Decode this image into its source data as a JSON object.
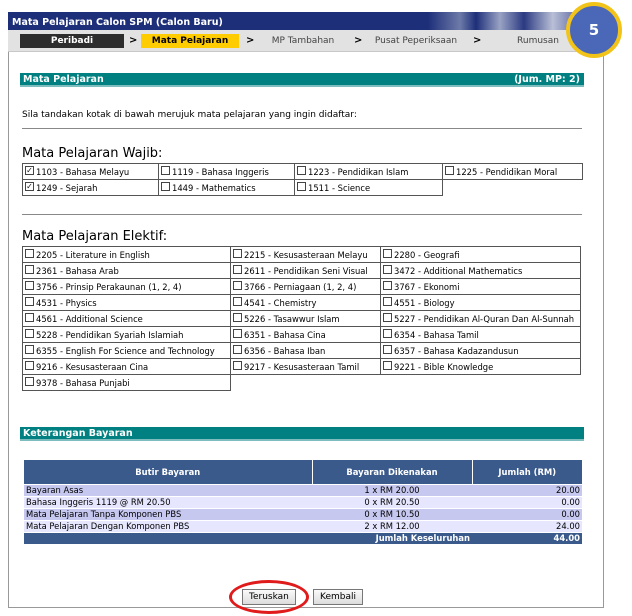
{
  "window": {
    "title": "Mata Pelajaran Calon SPM (Calon Baru)"
  },
  "badge": {
    "number": "5"
  },
  "steps": [
    {
      "label": "Peribadi"
    },
    {
      "label": "Mata Pelajaran"
    },
    {
      "label": "MP Tambahan"
    },
    {
      "label": "Pusat Peperiksaan"
    },
    {
      "label": "Rumusan"
    }
  ],
  "step_separator": ">",
  "subjects_section": {
    "title": "Mata Pelajaran",
    "count": "(Jum. MP: 2)"
  },
  "instruction": "Sila tandakan kotak di bawah merujuk mata pelajaran yang ingin didaftar:",
  "compulsory": {
    "heading": "Mata Pelajaran Wajib:",
    "rows": [
      [
        {
          "label": "1103 - Bahasa Melayu",
          "checked": true
        },
        {
          "label": "1119 - Bahasa Inggeris",
          "checked": false
        },
        {
          "label": "1223 - Pendidikan Islam",
          "checked": false
        },
        {
          "label": "1225 - Pendidikan Moral",
          "checked": false
        }
      ],
      [
        {
          "label": "1249 - Sejarah",
          "checked": true
        },
        {
          "label": "1449 - Mathematics",
          "checked": false
        },
        {
          "label": "1511 - Science",
          "checked": false
        }
      ]
    ]
  },
  "elective": {
    "heading": "Mata Pelajaran Elektif:",
    "rows": [
      [
        {
          "label": "2205 - Literature in English"
        },
        {
          "label": "2215 - Kesusasteraan Melayu"
        },
        {
          "label": "2280 - Geografi"
        }
      ],
      [
        {
          "label": "2361 - Bahasa Arab"
        },
        {
          "label": "2611 - Pendidikan Seni Visual"
        },
        {
          "label": "3472 - Additional Mathematics"
        }
      ],
      [
        {
          "label": "3756 - Prinsip Perakaunan (1, 2, 4)"
        },
        {
          "label": "3766 - Perniagaan (1, 2, 4)"
        },
        {
          "label": "3767 - Ekonomi"
        }
      ],
      [
        {
          "label": "4531 - Physics"
        },
        {
          "label": "4541 - Chemistry"
        },
        {
          "label": "4551 - Biology"
        }
      ],
      [
        {
          "label": "4561 - Additional Science"
        },
        {
          "label": "5226 - Tasawwur Islam"
        },
        {
          "label": "5227 - Pendidikan Al-Quran Dan Al-Sunnah"
        }
      ],
      [
        {
          "label": "5228 - Pendidikan Syariah Islamiah"
        },
        {
          "label": "6351 - Bahasa Cina"
        },
        {
          "label": "6354 - Bahasa Tamil"
        }
      ],
      [
        {
          "label": "6355 - English For Science and Technology"
        },
        {
          "label": "6356 - Bahasa Iban"
        },
        {
          "label": "6357 - Bahasa Kadazandusun"
        }
      ],
      [
        {
          "label": "9216 - Kesusasteraan Cina"
        },
        {
          "label": "9217 - Kesusasteraan Tamil"
        },
        {
          "label": "9221 - Bible Knowledge"
        }
      ],
      [
        {
          "label": "9378 - Bahasa Punjabi"
        }
      ]
    ]
  },
  "payment_section": {
    "title": "Keterangan Bayaran"
  },
  "payment": {
    "headers": [
      "Butir Bayaran",
      "Bayaran Dikenakan",
      "Jumlah (RM)"
    ],
    "rows": [
      {
        "item": "Bayaran Asas",
        "charge": "1 x RM 20.00",
        "amount": "20.00"
      },
      {
        "item": "Bahasa Inggeris 1119 @ RM 20.50",
        "charge": "0 x RM 20.50",
        "amount": "0.00"
      },
      {
        "item": "Mata Pelajaran Tanpa Komponen PBS",
        "charge": "0 x RM 10.50",
        "amount": "0.00"
      },
      {
        "item": "Mata Pelajaran Dengan Komponen PBS",
        "charge": "2 x RM 12.00",
        "amount": "24.00"
      }
    ],
    "total_label": "Jumlah Keseluruhan",
    "total_value": "44.00"
  },
  "buttons": {
    "next": "Teruskan",
    "back": "Kembali"
  },
  "colors": {
    "accent": "#008080",
    "title_bar": "#1e2f7a",
    "active_step": "#ffcc00",
    "highlight_ring": "#e01b1b"
  }
}
